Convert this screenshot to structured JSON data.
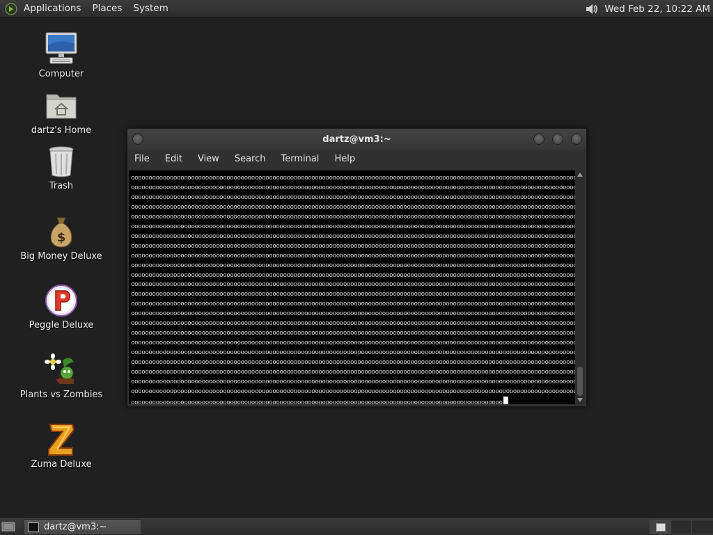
{
  "top_panel": {
    "menus": [
      "Applications",
      "Places",
      "System"
    ],
    "clock": "Wed Feb 22, 10:22 AM"
  },
  "desktop": {
    "icons": [
      {
        "label": "Computer",
        "icon": "computer-icon"
      },
      {
        "label": "dartz's Home",
        "icon": "home-folder-icon"
      },
      {
        "label": "Trash",
        "icon": "trash-icon"
      },
      {
        "label": "Big Money Deluxe",
        "icon": "money-bag-icon"
      },
      {
        "label": "Peggle Deluxe",
        "icon": "peggle-icon"
      },
      {
        "label": "Plants vs Zombies",
        "icon": "plants-vs-zombies-icon"
      },
      {
        "label": "Zuma Deluxe",
        "icon": "zuma-icon"
      }
    ]
  },
  "terminal": {
    "title": "dartz@vm3:~",
    "menu": [
      "File",
      "Edit",
      "View",
      "Search",
      "Terminal",
      "Help"
    ],
    "output_line": "oooooooooooooooooooooooooooooooooooooooooooooooooooooooooooooooooooooooooooooooooooooooooooooooooooooooooooooooooooooooooooooooooooo",
    "last_line": "ooooooooooooooooooooooooooooooooooooooooooooooooooooooooooooooooooooooooooooooooooooooooooooooooooooooooo",
    "full_lines": 23
  },
  "bottom_panel": {
    "task_label": "dartz@vm3:~"
  },
  "colors": {
    "desktop_bg": "#1f201f",
    "panel_bg": "#333433",
    "terminal_bg": "#000000"
  }
}
